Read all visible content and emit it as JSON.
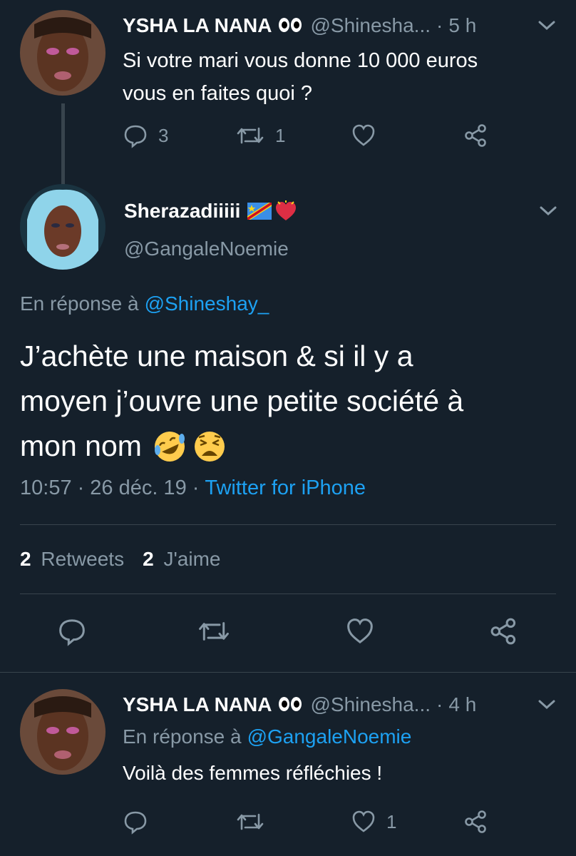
{
  "tweet1": {
    "name": "YSHA LA NANA",
    "handle": "@Shinesha...",
    "time": "5 h",
    "text_line1": "Si votre mari vous donne 10 000 euros",
    "text_line2": "vous en faites quoi ?",
    "reply_count": "3",
    "retweet_count": "1",
    "like_count": ""
  },
  "main": {
    "name": "Sherazadiiiii",
    "handle": "@GangaleNoemie",
    "reply_prefix": "En réponse à",
    "reply_to": "@Shineshay_",
    "text_line1": "J’achète une maison & si il y a",
    "text_line2": "moyen j’ouvre une petite société à",
    "text_line3": "mon nom",
    "time": "10:57",
    "date": "26 déc. 19",
    "source": "Twitter for iPhone",
    "retweets_count": "2",
    "retweets_label": "Retweets",
    "likes_count": "2",
    "likes_label": "J'aime"
  },
  "tweet3": {
    "name": "YSHA LA NANA",
    "handle": "@Shinesha...",
    "time": "4 h",
    "reply_prefix": "En réponse à",
    "reply_to": "@GangaleNoemie",
    "text": "Voilà des femmes réfléchies !",
    "reply_count": "",
    "retweet_count": "",
    "like_count": "1"
  },
  "separator": "·",
  "colors": {
    "background": "#15202b",
    "secondary_text": "#8899a6",
    "link": "#1da1f2",
    "divider": "#38444d"
  },
  "icons": [
    "reply-icon",
    "retweet-icon",
    "like-icon",
    "share-icon",
    "chevron-down-icon",
    "eyes-emoji",
    "rofl-emoji",
    "weary-emoji",
    "drc-flag-emoji",
    "heart-emoji"
  ]
}
